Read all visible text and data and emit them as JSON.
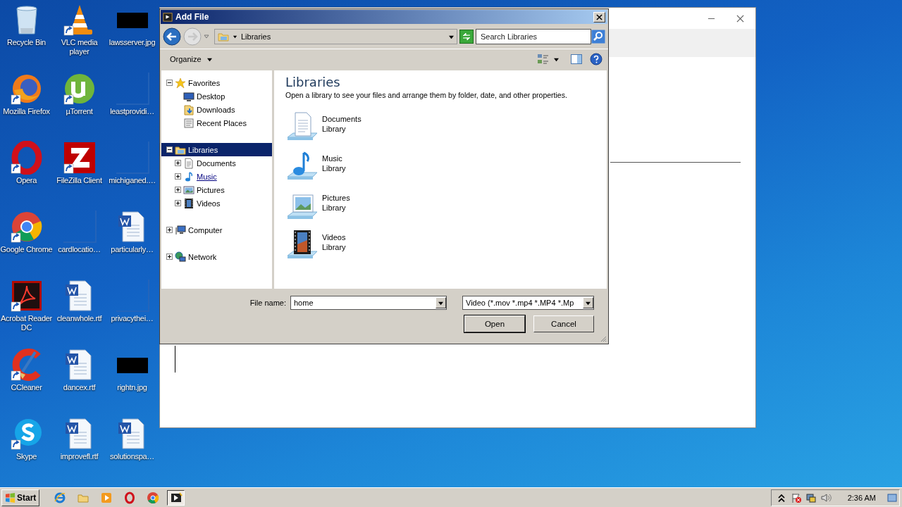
{
  "desktop_icons": [
    {
      "label": "Recycle Bin",
      "kind": "recycle",
      "shortcut": false
    },
    {
      "label": "Mozilla Firefox",
      "kind": "firefox",
      "shortcut": true
    },
    {
      "label": "Opera",
      "kind": "opera",
      "shortcut": true
    },
    {
      "label": "Google Chrome",
      "kind": "chrome",
      "shortcut": true
    },
    {
      "label": "Acrobat Reader DC",
      "kind": "acrobat",
      "shortcut": true
    },
    {
      "label": "CCleaner",
      "kind": "ccleaner",
      "shortcut": true
    },
    {
      "label": "Skype",
      "kind": "skype",
      "shortcut": true
    },
    {
      "label": "VLC media player",
      "kind": "vlc",
      "shortcut": true
    },
    {
      "label": "µTorrent",
      "kind": "utorrent",
      "shortcut": true
    },
    {
      "label": "FileZilla Client",
      "kind": "filezilla",
      "shortcut": true
    },
    {
      "label": "cardlocatio…",
      "kind": "blank",
      "shortcut": false
    },
    {
      "label": "cleanwhole.rtf",
      "kind": "word",
      "shortcut": false
    },
    {
      "label": "dancex.rtf",
      "kind": "word",
      "shortcut": false
    },
    {
      "label": "improvefl.rtf",
      "kind": "word",
      "shortcut": false
    },
    {
      "label": "lawsserver.jpg",
      "kind": "image",
      "shortcut": false
    },
    {
      "label": "leastprovidi…",
      "kind": "blank",
      "shortcut": false
    },
    {
      "label": "michiganed.…",
      "kind": "blank",
      "shortcut": false
    },
    {
      "label": "particularly…",
      "kind": "word",
      "shortcut": false
    },
    {
      "label": "privacythei…",
      "kind": "blank",
      "shortcut": false
    },
    {
      "label": "rightn.jpg",
      "kind": "image",
      "shortcut": false
    },
    {
      "label": "solutionspa…",
      "kind": "word",
      "shortcut": false
    }
  ],
  "dialog": {
    "title": "Add File",
    "address": "Libraries",
    "search": {
      "placeholder": "Search Libraries"
    },
    "organize": "Organize",
    "tree": [
      {
        "label": "Favorites",
        "kind": "star",
        "expanded": true,
        "selected": false,
        "children": [
          {
            "label": "Desktop",
            "kind": "desktop",
            "hovered": false
          },
          {
            "label": "Downloads",
            "kind": "downloads",
            "hovered": false
          },
          {
            "label": "Recent Places",
            "kind": "recent",
            "hovered": false
          }
        ]
      },
      {
        "label": "Libraries",
        "kind": "libraries",
        "expanded": true,
        "selected": true,
        "children": [
          {
            "label": "Documents",
            "kind": "documents",
            "expanded": false,
            "hovered": false
          },
          {
            "label": "Music",
            "kind": "music",
            "expanded": false,
            "hovered": true
          },
          {
            "label": "Pictures",
            "kind": "pictures",
            "expanded": false,
            "hovered": false
          },
          {
            "label": "Videos",
            "kind": "videos",
            "expanded": false,
            "hovered": false
          }
        ]
      },
      {
        "label": "Computer",
        "kind": "computer",
        "expanded": false,
        "selected": false
      },
      {
        "label": "Network",
        "kind": "network",
        "expanded": false,
        "selected": false
      }
    ],
    "heading": "Libraries",
    "description": "Open a library to see your files and arrange them by folder, date, and other properties.",
    "libraries": [
      {
        "name": "Documents",
        "subtitle": "Library",
        "kind": "documents"
      },
      {
        "name": "Music",
        "subtitle": "Library",
        "kind": "music"
      },
      {
        "name": "Pictures",
        "subtitle": "Library",
        "kind": "pictures"
      },
      {
        "name": "Videos",
        "subtitle": "Library",
        "kind": "videos"
      }
    ],
    "file_name_label": "File name:",
    "file_name": "home",
    "file_type": "Video (*.mov *.mp4 *.MP4 *.Mp",
    "buttons": [
      {
        "label": "Open",
        "default": true
      },
      {
        "label": "Cancel",
        "default": false
      }
    ]
  },
  "taskbar": {
    "start": "Start",
    "apps": [
      {
        "kind": "ie",
        "selected": false
      },
      {
        "kind": "folder",
        "selected": false
      },
      {
        "kind": "media",
        "selected": false
      },
      {
        "kind": "opera",
        "selected": false
      },
      {
        "kind": "chrome",
        "selected": false
      },
      {
        "kind": "vlc",
        "selected": true
      }
    ],
    "clock": "2:36 AM"
  }
}
